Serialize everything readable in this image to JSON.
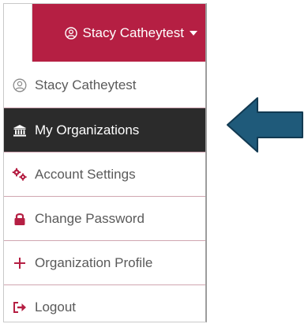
{
  "user_menu": {
    "toggle_label": "Stacy Catheytest",
    "toggle_icon": "user-circle-icon",
    "caret_icon": "caret-down-icon",
    "items": [
      {
        "label": "Stacy Catheytest",
        "icon": "user-circle-icon",
        "active": false
      },
      {
        "label": "My Organizations",
        "icon": "bank-icon",
        "active": true
      },
      {
        "label": "Account Settings",
        "icon": "gears-icon",
        "active": false
      },
      {
        "label": "Change Password",
        "icon": "lock-icon",
        "active": false
      },
      {
        "label": "Organization Profile",
        "icon": "plus-icon",
        "active": false
      },
      {
        "label": "Logout",
        "icon": "sign-out-icon",
        "active": false
      }
    ]
  },
  "colors": {
    "brand": "#b51f43",
    "active_bg": "#2b2b2b",
    "arrow": "#1f5a7a",
    "item_text": "#5a5a5a"
  }
}
